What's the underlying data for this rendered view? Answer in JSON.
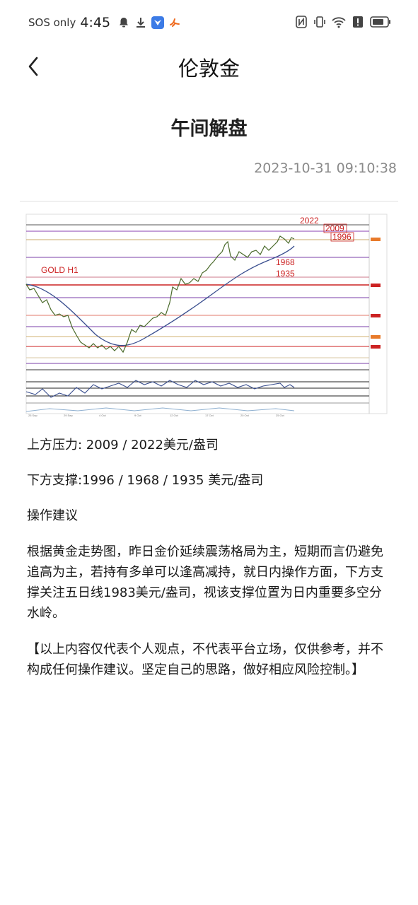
{
  "status_bar": {
    "carrier": "SOS only",
    "time": "4:45"
  },
  "header": {
    "title": "伦敦金",
    "back_icon": "chevron-left-icon"
  },
  "article": {
    "title": "午间解盘",
    "datetime": "2023-10-31 09:10:38",
    "chart": {
      "instrument_label": "GOLD H1",
      "levels": [
        "2022",
        "2009",
        "1996",
        "1968",
        "1935"
      ]
    },
    "paragraphs": [
      "上方压力: 2009 / 2022美元/盎司",
      "下方支撑:1996 / 1968 / 1935 美元/盎司",
      "操作建议",
      "根据黄金走势图，昨日金价延续震荡格局为主，短期而言仍避免追高为主，若持有多单可以逢高减持，就日内操作方面，下方支撑关注五日线1983美元/盎司，视该支撑位置为日内重要多空分水岭。",
      "【以上内容仅代表个人观点，不代表平台立场，仅供参考，并不构成任何操作建议。坚定自己的思路，做好相应风险控制。】"
    ]
  }
}
